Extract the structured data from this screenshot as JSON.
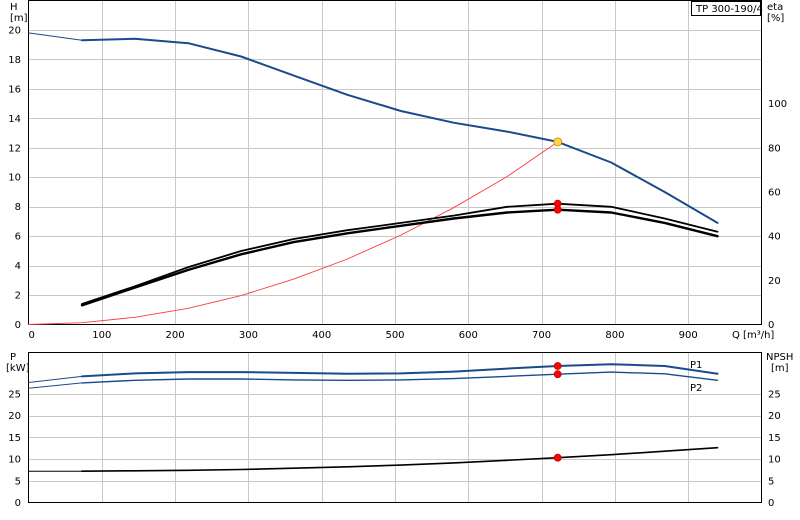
{
  "title_box": "TP 300-190/4",
  "colors": {
    "head_curve": "#1a4b8c",
    "eff_curve": "#000000",
    "system_curve": "#ff3b3b",
    "power_curve": "#1a4b8c",
    "npsh_curve": "#000000",
    "duty_point": "#ff0000",
    "duty_point_head": "#ffd54a",
    "grid": "#c8c8c8"
  },
  "chart_data": [
    {
      "type": "line",
      "x_axis": {
        "label_line1": "Q [m³/h]",
        "range": [
          0,
          1000
        ],
        "ticks": [
          0,
          100,
          200,
          300,
          400,
          500,
          600,
          700,
          800,
          900
        ]
      },
      "y_axis_left": {
        "label_line1": "H",
        "label_line2": "[m]",
        "range": [
          0,
          22
        ],
        "ticks": [
          0,
          2,
          4,
          6,
          8,
          10,
          12,
          14,
          16,
          18,
          20
        ]
      },
      "y_axis_right": {
        "label_line1": "eta",
        "label_line2": "[%]",
        "range": [
          0,
          146.7
        ],
        "ticks": [
          0,
          20,
          40,
          60,
          80,
          100
        ]
      },
      "grid": true,
      "series": [
        {
          "key": "head",
          "axis": "left",
          "points": [
            [
              0,
              19.8
            ],
            [
              73,
              19.3
            ],
            [
              145,
              19.4
            ],
            [
              218,
              19.1
            ],
            [
              290,
              18.2
            ],
            [
              362,
              16.9
            ],
            [
              435,
              15.6
            ],
            [
              508,
              14.5
            ],
            [
              580,
              13.7
            ],
            [
              653,
              13.1
            ],
            [
              722,
              12.4
            ],
            [
              795,
              11.0
            ],
            [
              868,
              9.0
            ],
            [
              940,
              6.9
            ]
          ]
        },
        {
          "key": "eta_upper",
          "axis": "right",
          "points": [
            [
              73,
              9.3
            ],
            [
              145,
              17.3
            ],
            [
              218,
              26.0
            ],
            [
              290,
              33.3
            ],
            [
              362,
              38.7
            ],
            [
              435,
              42.7
            ],
            [
              508,
              46.0
            ],
            [
              580,
              49.3
            ],
            [
              653,
              53.3
            ],
            [
              722,
              54.7
            ],
            [
              795,
              53.3
            ],
            [
              868,
              48.0
            ],
            [
              940,
              42.0
            ]
          ]
        },
        {
          "key": "eta_lower",
          "axis": "right",
          "points": [
            [
              73,
              8.7
            ],
            [
              145,
              16.7
            ],
            [
              218,
              24.7
            ],
            [
              290,
              31.8
            ],
            [
              362,
              37.3
            ],
            [
              435,
              41.3
            ],
            [
              508,
              44.7
            ],
            [
              580,
              48.0
            ],
            [
              653,
              50.7
            ],
            [
              722,
              52.0
            ],
            [
              795,
              50.7
            ],
            [
              868,
              46.0
            ],
            [
              940,
              40.0
            ]
          ]
        },
        {
          "key": "system",
          "axis": "left",
          "points": [
            [
              0,
              0
            ],
            [
              73,
              0.12
            ],
            [
              145,
              0.49
            ],
            [
              218,
              1.1
            ],
            [
              290,
              1.96
            ],
            [
              362,
              3.08
            ],
            [
              435,
              4.45
            ],
            [
              508,
              6.07
            ],
            [
              580,
              7.93
            ],
            [
              653,
              10.04
            ],
            [
              722,
              12.4
            ]
          ]
        }
      ],
      "duty_points": [
        {
          "key": "head_duty",
          "axis": "left",
          "x": 722,
          "y": 12.4
        },
        {
          "key": "eta_duty_upper",
          "axis": "right",
          "x": 722,
          "y": 54.7
        },
        {
          "key": "eta_duty_lower",
          "axis": "right",
          "x": 722,
          "y": 52.0
        }
      ]
    },
    {
      "type": "line",
      "x_axis": {
        "range": [
          0,
          1000
        ]
      },
      "y_axis_left": {
        "label_line1": "P",
        "label_line2": "[kW]",
        "range": [
          0,
          34.5
        ],
        "ticks": [
          0,
          5,
          10,
          15,
          20,
          25
        ]
      },
      "y_axis_right": {
        "label_line1": "NPSH",
        "label_line2": "[m]",
        "range": [
          0,
          34.5
        ],
        "ticks": [
          0,
          5,
          10,
          15,
          20,
          25
        ]
      },
      "grid": true,
      "series": [
        {
          "key": "p1",
          "name": "P1",
          "axis": "left",
          "points": [
            [
              0,
              27.6
            ],
            [
              73,
              29.0
            ],
            [
              145,
              29.7
            ],
            [
              218,
              30.0
            ],
            [
              290,
              30.0
            ],
            [
              362,
              29.8
            ],
            [
              435,
              29.6
            ],
            [
              508,
              29.7
            ],
            [
              580,
              30.1
            ],
            [
              653,
              30.8
            ],
            [
              722,
              31.4
            ],
            [
              795,
              31.8
            ],
            [
              868,
              31.4
            ],
            [
              940,
              29.6
            ]
          ]
        },
        {
          "key": "p2",
          "name": "P2",
          "axis": "left",
          "points": [
            [
              0,
              26.3
            ],
            [
              73,
              27.5
            ],
            [
              145,
              28.1
            ],
            [
              218,
              28.4
            ],
            [
              290,
              28.4
            ],
            [
              362,
              28.2
            ],
            [
              435,
              28.1
            ],
            [
              508,
              28.2
            ],
            [
              580,
              28.5
            ],
            [
              653,
              29.0
            ],
            [
              722,
              29.5
            ],
            [
              795,
              30.0
            ],
            [
              868,
              29.6
            ],
            [
              940,
              28.1
            ]
          ]
        },
        {
          "key": "npsh",
          "axis": "right",
          "points": [
            [
              0,
              7.2
            ],
            [
              73,
              7.2
            ],
            [
              145,
              7.3
            ],
            [
              218,
              7.4
            ],
            [
              290,
              7.6
            ],
            [
              362,
              7.9
            ],
            [
              435,
              8.2
            ],
            [
              508,
              8.6
            ],
            [
              580,
              9.1
            ],
            [
              653,
              9.7
            ],
            [
              722,
              10.3
            ],
            [
              795,
              11.0
            ],
            [
              868,
              11.8
            ],
            [
              940,
              12.6
            ]
          ]
        }
      ],
      "duty_points": [
        {
          "key": "p1_duty",
          "axis": "left",
          "x": 722,
          "y": 31.4
        },
        {
          "key": "p2_duty",
          "axis": "left",
          "x": 722,
          "y": 29.5
        },
        {
          "key": "npsh_duty",
          "axis": "right",
          "x": 722,
          "y": 10.3
        }
      ]
    }
  ]
}
